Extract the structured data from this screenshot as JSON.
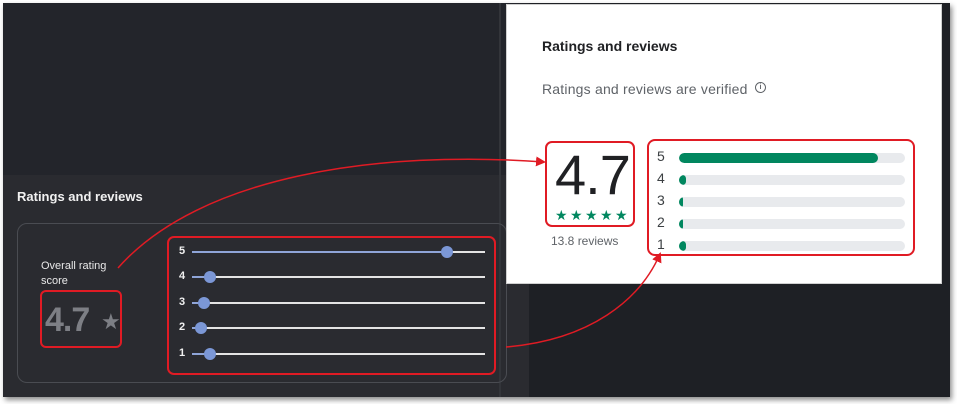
{
  "dark_ui": {
    "section_title": "Ratings and reviews",
    "overall_label": "Overall rating score",
    "score": "4.7",
    "star_icon": "star-icon",
    "slider_accent": "#7b97d6",
    "sliders": [
      {
        "label": "5",
        "fraction": 0.87
      },
      {
        "label": "4",
        "fraction": 0.06
      },
      {
        "label": "3",
        "fraction": 0.04
      },
      {
        "label": "2",
        "fraction": 0.03
      },
      {
        "label": "1",
        "fraction": 0.06
      }
    ]
  },
  "light_ui": {
    "section_title": "Ratings and reviews",
    "verified_text": "Ratings and reviews are verified",
    "info_icon": "info-icon",
    "score": "4.7",
    "stars_icon": "stars-rating-icon",
    "star_fraction": 0.94,
    "reviews_count": "13.8 reviews",
    "bar_color": "#01875f",
    "bars": [
      {
        "label": "5",
        "fraction": 0.88
      },
      {
        "label": "4",
        "fraction": 0.03
      },
      {
        "label": "3",
        "fraction": 0.01
      },
      {
        "label": "2",
        "fraction": 0.01
      },
      {
        "label": "1",
        "fraction": 0.03
      }
    ]
  },
  "annotations": {
    "highlight_color": "#e01b24"
  }
}
